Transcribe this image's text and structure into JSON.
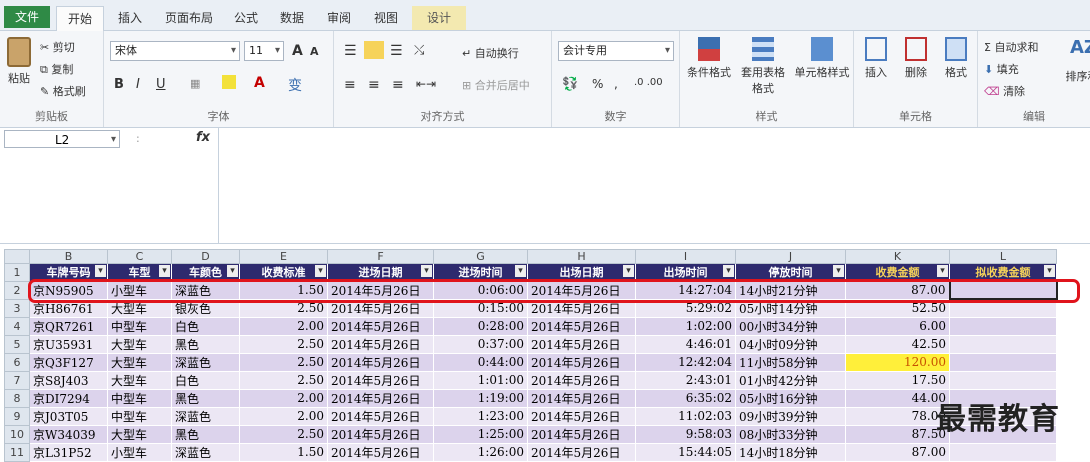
{
  "ribbon_tabs": [
    "文件",
    "开始",
    "插入",
    "页面布局",
    "公式",
    "数据",
    "审阅",
    "视图",
    "设计"
  ],
  "clipboard": {
    "paste": "粘贴",
    "cut": "剪切",
    "copy": "复制",
    "format_painter": "格式刷",
    "label": "剪贴板"
  },
  "font": {
    "name": "宋体",
    "size": "11",
    "grow": "A",
    "shrink": "A",
    "label": "字体",
    "bold": "B",
    "italic": "I",
    "underline": "U",
    "phonetic": "变"
  },
  "alignment": {
    "wrap": "自动换行",
    "merge": "合并后居中",
    "label": "对齐方式"
  },
  "number": {
    "format": "会计专用",
    "percent": "%",
    "comma": ",",
    "label": "数字"
  },
  "styles": {
    "conditional": "条件格式",
    "table": "套用表格格式",
    "cell": "单元格样式",
    "label": "样式"
  },
  "cells": {
    "insert": "插入",
    "delete": "删除",
    "format": "格式",
    "label": "单元格"
  },
  "editing": {
    "autosum": "Σ 自动求和",
    "fill": "填充",
    "clear": "清除",
    "sort": "排序和",
    "label": "编辑"
  },
  "namebox": "L2",
  "fx": "fx",
  "column_letters": [
    "B",
    "C",
    "D",
    "E",
    "F",
    "G",
    "H",
    "I",
    "J",
    "K",
    "L"
  ],
  "headers": [
    "车牌号码",
    "车型",
    "车颜色",
    "收费标准",
    "进场日期",
    "进场时间",
    "出场日期",
    "出场时间",
    "停放时间",
    "收费金额",
    "拟收费金额"
  ],
  "rows": [
    {
      "n": "2",
      "c": [
        "京N95905",
        "小型车",
        "深蓝色",
        "1.50",
        "2014年5月26日",
        "0:06:00",
        "2014年5月26日",
        "14:27:04",
        "14小时21分钟",
        "87.00",
        ""
      ]
    },
    {
      "n": "3",
      "c": [
        "京H86761",
        "大型车",
        "银灰色",
        "2.50",
        "2014年5月26日",
        "0:15:00",
        "2014年5月26日",
        "5:29:02",
        "05小时14分钟",
        "52.50",
        ""
      ]
    },
    {
      "n": "4",
      "c": [
        "京QR7261",
        "中型车",
        "白色",
        "2.00",
        "2014年5月26日",
        "0:28:00",
        "2014年5月26日",
        "1:02:00",
        "00小时34分钟",
        "6.00",
        ""
      ]
    },
    {
      "n": "5",
      "c": [
        "京U35931",
        "大型车",
        "黑色",
        "2.50",
        "2014年5月26日",
        "0:37:00",
        "2014年5月26日",
        "4:46:01",
        "04小时09分钟",
        "42.50",
        ""
      ]
    },
    {
      "n": "6",
      "c": [
        "京Q3F127",
        "大型车",
        "深蓝色",
        "2.50",
        "2014年5月26日",
        "0:44:00",
        "2014年5月26日",
        "12:42:04",
        "11小时58分钟",
        "120.00",
        ""
      ]
    },
    {
      "n": "7",
      "c": [
        "京S8J403",
        "大型车",
        "白色",
        "2.50",
        "2014年5月26日",
        "1:01:00",
        "2014年5月26日",
        "2:43:01",
        "01小时42分钟",
        "17.50",
        ""
      ]
    },
    {
      "n": "8",
      "c": [
        "京DI7294",
        "中型车",
        "黑色",
        "2.00",
        "2014年5月26日",
        "1:19:00",
        "2014年5月26日",
        "6:35:02",
        "05小时16分钟",
        "44.00",
        ""
      ]
    },
    {
      "n": "9",
      "c": [
        "京J03T05",
        "中型车",
        "深蓝色",
        "2.00",
        "2014年5月26日",
        "1:23:00",
        "2014年5月26日",
        "11:02:03",
        "09小时39分钟",
        "78.00",
        ""
      ]
    },
    {
      "n": "10",
      "c": [
        "京W34039",
        "大型车",
        "黑色",
        "2.50",
        "2014年5月26日",
        "1:25:00",
        "2014年5月26日",
        "9:58:03",
        "08小时33分钟",
        "87.50",
        ""
      ]
    },
    {
      "n": "11",
      "c": [
        "京L31P52",
        "小型车",
        "深蓝色",
        "1.50",
        "2014年5月26日",
        "1:26:00",
        "2014年5月26日",
        "15:44:05",
        "14小时18分钟",
        "87.00",
        ""
      ]
    }
  ],
  "watermark": "最需教育"
}
